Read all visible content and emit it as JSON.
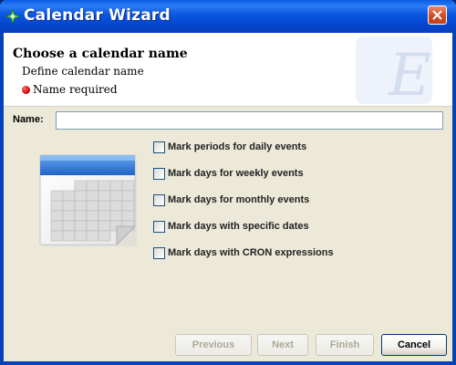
{
  "window": {
    "title": "Calendar Wizard"
  },
  "header": {
    "title": "Choose a calendar name",
    "subtitle": "Define calendar name",
    "requirement": "Name required",
    "watermark_letter": "E"
  },
  "form": {
    "name_label": "Name:",
    "name_value": ""
  },
  "options": [
    {
      "label": "Mark periods for daily events",
      "checked": false
    },
    {
      "label": "Mark days for weekly events",
      "checked": false
    },
    {
      "label": "Mark days for monthly events",
      "checked": false
    },
    {
      "label": "Mark days with specific dates",
      "checked": false
    },
    {
      "label": "Mark days with CRON expressions",
      "checked": false
    }
  ],
  "buttons": {
    "previous": "Previous",
    "next": "Next",
    "finish": "Finish",
    "cancel": "Cancel"
  },
  "colors": {
    "titlebar": "#0b56e0",
    "required_dot": "#c00000",
    "dialog_bg": "#ece9d8"
  }
}
